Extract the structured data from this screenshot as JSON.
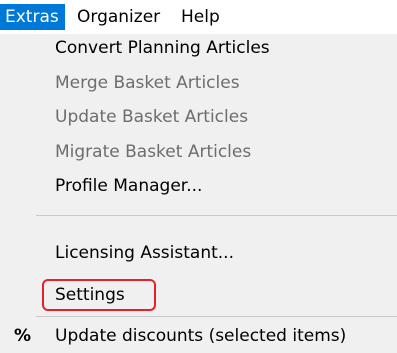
{
  "menubar": {
    "items": [
      {
        "label": "Extras",
        "active": true
      },
      {
        "label": "Organizer",
        "active": false
      },
      {
        "label": "Help",
        "active": false
      }
    ]
  },
  "dropdown": {
    "items": [
      {
        "label": "Convert Planning Articles",
        "enabled": true
      },
      {
        "label": "Merge Basket Articles",
        "enabled": false
      },
      {
        "label": "Update Basket Articles",
        "enabled": false
      },
      {
        "label": "Migrate Basket Articles",
        "enabled": false
      },
      {
        "label": "Profile Manager...",
        "enabled": true
      },
      {
        "label": "Licensing Assistant...",
        "enabled": true
      },
      {
        "label": "Settings",
        "enabled": true,
        "highlighted": true
      },
      {
        "label": "Update discounts (selected items)",
        "enabled": true,
        "icon": "percent-icon",
        "icon_glyph": "%"
      }
    ]
  },
  "colors": {
    "menu_active_bg": "#0078d7",
    "highlight_border": "#e8202a",
    "disabled_text": "#6d6d6d"
  }
}
